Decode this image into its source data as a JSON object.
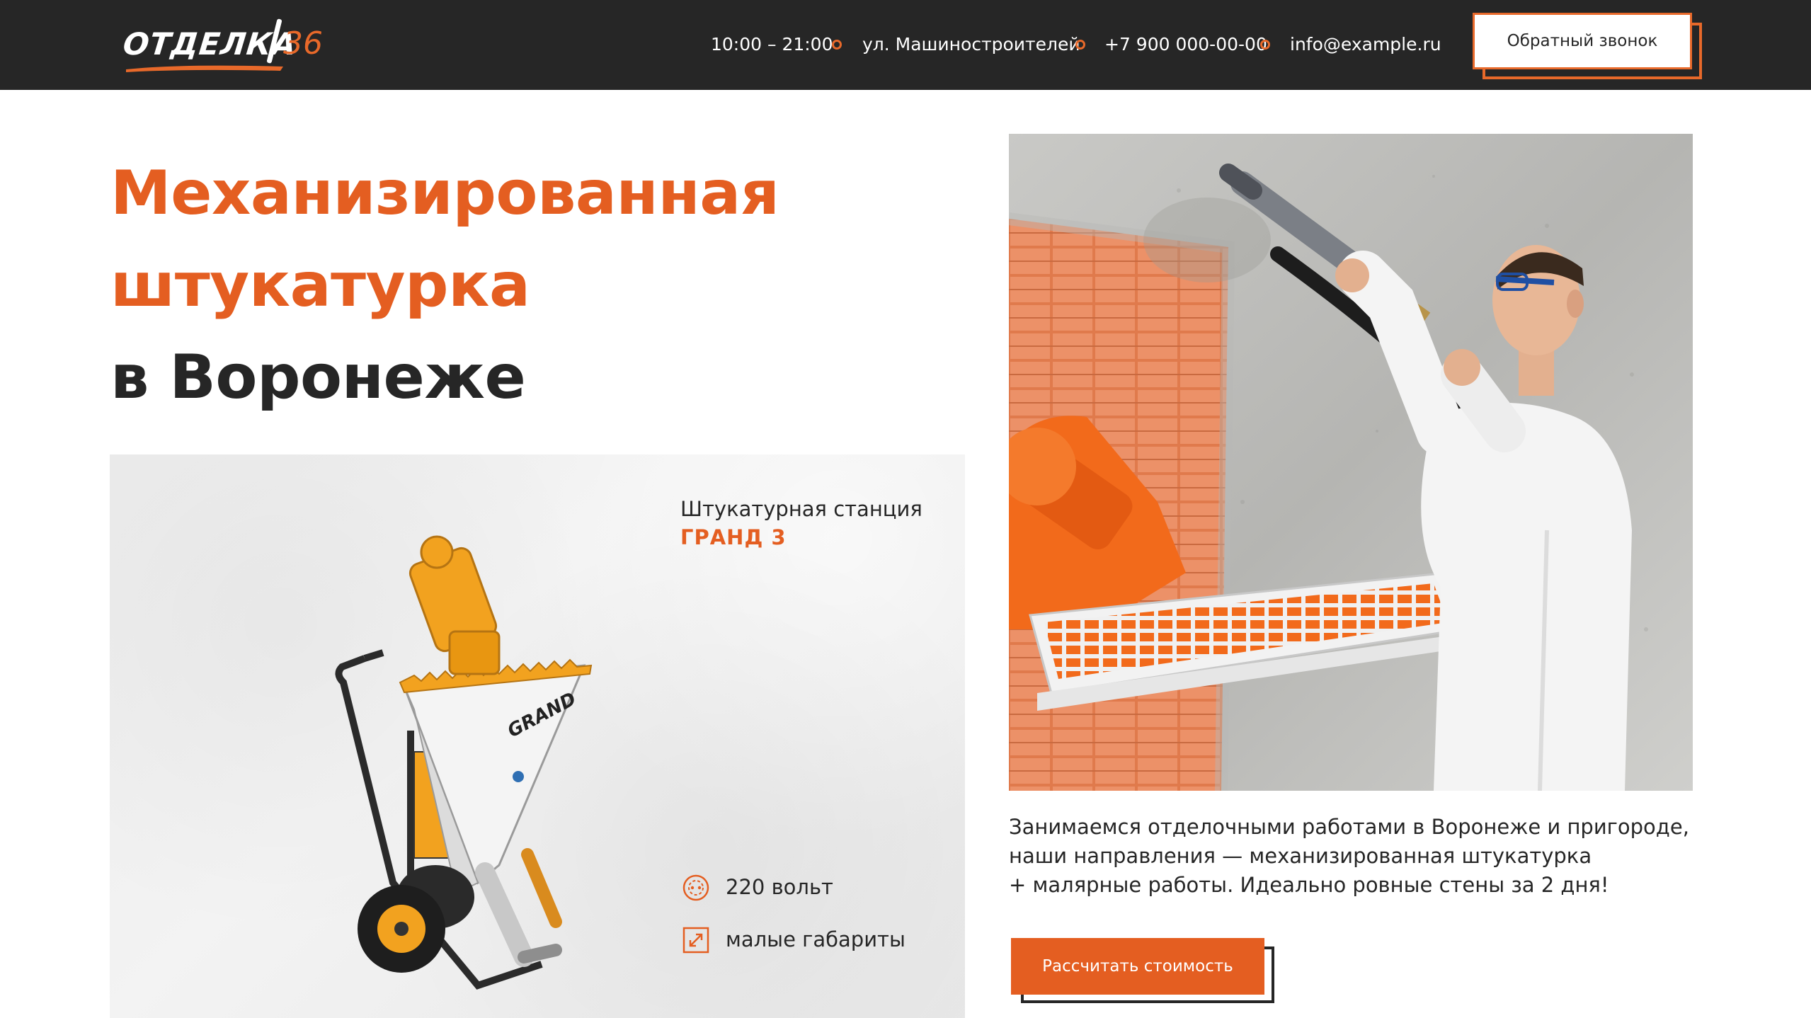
{
  "header": {
    "logo_text": "ОТДЕЛКА",
    "logo_number": "36",
    "hours": "10:00 – 21:00",
    "address": "ул. Машиностроителей",
    "phone": "+7 900 000-00-00",
    "email": "info@example.ru",
    "callback_label": "Обратный звонок"
  },
  "hero": {
    "title_line1": "Механизированная",
    "title_line2": "штукатурка",
    "title_line3": "в Воронеже"
  },
  "product": {
    "subtitle": "Штукатурная станция",
    "model": "ГРАНД 3",
    "brand_on_machine": "GRAND",
    "features": [
      {
        "icon": "socket-icon",
        "label": "220 вольт"
      },
      {
        "icon": "resize-icon",
        "label": "малые габариты"
      }
    ]
  },
  "about": {
    "line1": "Занимаемся отделочными работами в Воронеже и пригороде,",
    "line2": "наши направления — механизированная штукатурка",
    "line3": "+ малярные работы. Идеально ровные стены за 2 дня!",
    "cta_label": "Рассчитать стоимость"
  },
  "colors": {
    "accent": "#e45e21",
    "header_bg": "#262626",
    "text": "#262626"
  }
}
